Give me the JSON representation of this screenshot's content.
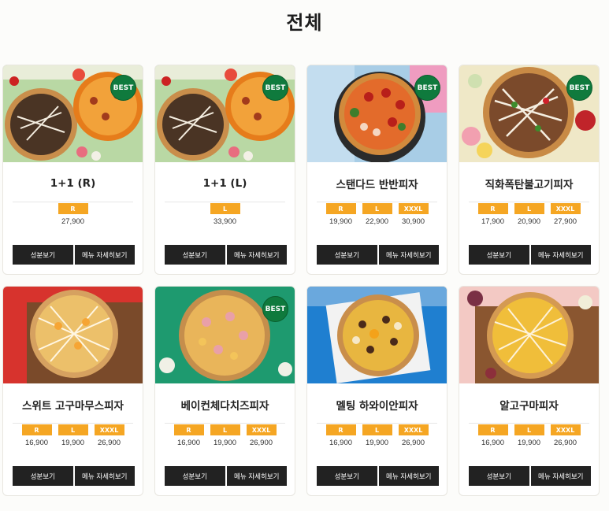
{
  "page": {
    "title": "전체"
  },
  "best_label": "BEST",
  "buttons": {
    "ingredients": "성분보기",
    "details": "메뉴 자세히보기"
  },
  "colors": {
    "size_badge": "#f5a623",
    "best_badge": "#0f7a3d",
    "button": "#222222"
  },
  "menu": [
    {
      "name": "1+1 (R)",
      "best": true,
      "sizes": [
        {
          "label": "R",
          "price": "27,900"
        }
      ]
    },
    {
      "name": "1+1 (L)",
      "best": true,
      "sizes": [
        {
          "label": "L",
          "price": "33,900"
        }
      ]
    },
    {
      "name": "스탠다드 반반피자",
      "best": true,
      "sizes": [
        {
          "label": "R",
          "price": "19,900"
        },
        {
          "label": "L",
          "price": "22,900"
        },
        {
          "label": "XXXL",
          "price": "30,900"
        }
      ]
    },
    {
      "name": "직화폭탄불고기피자",
      "best": true,
      "sizes": [
        {
          "label": "R",
          "price": "17,900"
        },
        {
          "label": "L",
          "price": "20,900"
        },
        {
          "label": "XXXL",
          "price": "27,900"
        }
      ]
    },
    {
      "name": "스위트 고구마무스피자",
      "best": false,
      "sizes": [
        {
          "label": "R",
          "price": "16,900"
        },
        {
          "label": "L",
          "price": "19,900"
        },
        {
          "label": "XXXL",
          "price": "26,900"
        }
      ]
    },
    {
      "name": "베이컨체다치즈피자",
      "best": true,
      "sizes": [
        {
          "label": "R",
          "price": "16,900"
        },
        {
          "label": "L",
          "price": "19,900"
        },
        {
          "label": "XXXL",
          "price": "26,900"
        }
      ]
    },
    {
      "name": "멜팅 하와이안피자",
      "best": false,
      "sizes": [
        {
          "label": "R",
          "price": "16,900"
        },
        {
          "label": "L",
          "price": "19,900"
        },
        {
          "label": "XXXL",
          "price": "26,900"
        }
      ]
    },
    {
      "name": "알고구마피자",
      "best": false,
      "sizes": [
        {
          "label": "R",
          "price": "16,900"
        },
        {
          "label": "L",
          "price": "19,900"
        },
        {
          "label": "XXXL",
          "price": "26,900"
        }
      ]
    }
  ]
}
